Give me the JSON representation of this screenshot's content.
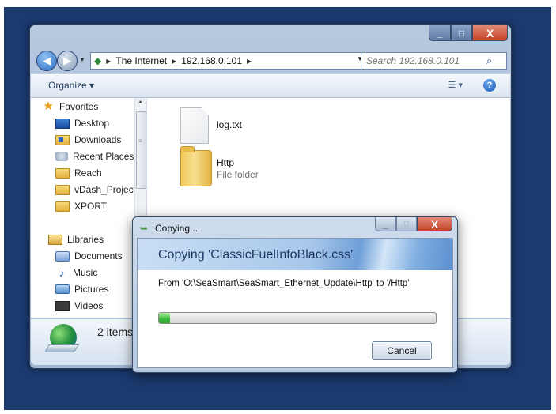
{
  "explorer": {
    "caption_buttons": {
      "minimize": "_",
      "maximize": "□",
      "close": "X"
    },
    "address": [
      "The Internet",
      "192.168.0.101"
    ],
    "search_placeholder": "Search 192.168.0.101",
    "toolbar": {
      "organize": "Organize ▾"
    },
    "sidebar": {
      "favorites_label": "Favorites",
      "favorites": [
        "Desktop",
        "Downloads",
        "Recent Places",
        "Reach",
        "vDash_Projects",
        "XPORT"
      ],
      "libraries_label": "Libraries",
      "libraries": [
        "Documents",
        "Music",
        "Pictures",
        "Videos"
      ]
    },
    "files": [
      {
        "name": "log.txt",
        "type": ""
      },
      {
        "name": "Http",
        "type": "File folder"
      }
    ],
    "details": {
      "item_count": "2 items"
    }
  },
  "copy_dialog": {
    "title": "Copying...",
    "heading": "Copying 'ClassicFuelInfoBlack.css'",
    "from_to": "From 'O:\\SeaSmart\\SeaSmart_Ethernet_Update\\Http' to '/Http'",
    "progress_fraction": 0.04,
    "cancel_label": "Cancel"
  },
  "colors": {
    "desktop": "#1b3a70",
    "progress": "#3fc03c",
    "accent": "#1d3763"
  }
}
